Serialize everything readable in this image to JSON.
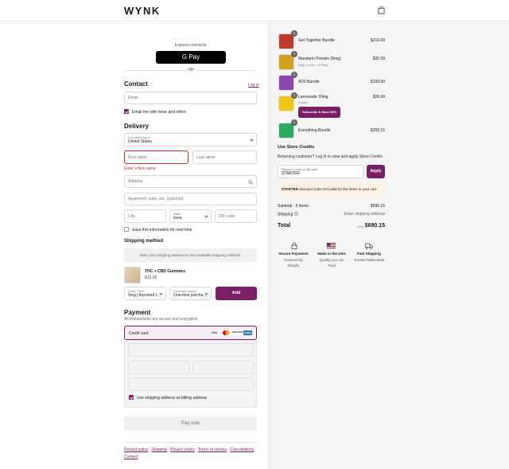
{
  "brand": {
    "logo": "WYNK",
    "accent": "#7a1f66",
    "error": "#d92d20"
  },
  "icons": {
    "cart": "shopping-bag-icon"
  },
  "express": {
    "label": "Express checkout",
    "gpay": "G Pay",
    "or": "OR"
  },
  "contact": {
    "title": "Contact",
    "login": "Log in",
    "email_placeholder": "Email",
    "newsletter": "Email me with news and offers",
    "newsletter_checked": true
  },
  "delivery": {
    "title": "Delivery",
    "country_label": "Country/Region",
    "country_value": "United States",
    "first_name": "First name",
    "last_name": "Last name",
    "first_name_error": "Enter a first name",
    "address": "Address",
    "apartment": "Apartment, suite, etc. (optional)",
    "city": "City",
    "state_label": "State",
    "state_value": "Iowa",
    "zip": "ZIP code",
    "save_info": "Save this information for next time"
  },
  "shipping_method": {
    "title": "Shipping method",
    "notice": "Enter your shipping address to view available shipping methods."
  },
  "upsell": {
    "name": "THC + CBD Gummies",
    "price": "$19.99",
    "dose_label": "Dose / Size",
    "dose_value": "5mg | Assorted f...",
    "purchase_label": "Purchase option",
    "purchase_value": "One-time purcha...",
    "add": "Add"
  },
  "payment": {
    "title": "Payment",
    "subtitle": "All transactions are secure and encrypted.",
    "method": "Credit card",
    "cards": [
      "VISA",
      "MC",
      "DISCOVER",
      "AMEX"
    ],
    "billing_same": "Use shipping address as billing address",
    "pay_now": "Pay now"
  },
  "footer": {
    "links": [
      "Refund policy",
      "Shipping",
      "Privacy policy",
      "Terms of service",
      "Cancellations",
      "Contact"
    ]
  },
  "cart": {
    "items": [
      {
        "name": "Get Together Bundle",
        "sub": "",
        "qty": "1",
        "price": "$219.99",
        "color": "#c0392b"
      },
      {
        "name": "Mandarin Pomelo (5mg)",
        "sub": "5Mg / 12oz) - 6 Pack",
        "qty": "1",
        "price": "$35.99",
        "color": "#d4a017"
      },
      {
        "name": "4/20 Bundle",
        "sub": "",
        "qty": "1",
        "price": "$199.00",
        "color": "#8e44ad"
      },
      {
        "name": "Lemonade 10mg",
        "sub": "4 pack",
        "qty": "1",
        "price": "$26.99",
        "color": "#f1c40f"
      },
      {
        "name": "Everything Bundle",
        "sub": "",
        "qty": "1",
        "price": "$208.15",
        "color": "#27ae60"
      }
    ],
    "subscribe_label": "Subscribe & Save 20%"
  },
  "store_credit": {
    "title": "Use Store Credits",
    "text": "Returning customer? Log in to view and apply Store Credits"
  },
  "discount": {
    "label": "Discount code or gift card",
    "value": "STARTER",
    "apply": "Apply",
    "code": "STARTER",
    "notice": " discount code isn't valid for the items in your cart"
  },
  "summary": {
    "subtotal_label": "Subtotal · 5 items",
    "subtotal": "$690.15",
    "shipping_label": "Shipping",
    "shipping_value": "Enter shipping address",
    "total_label": "Total",
    "currency": "USD",
    "total": "$690.15"
  },
  "badges": [
    {
      "title": "Secure Payments",
      "sub1": "Powered by",
      "sub2": "Shopify",
      "icon": "lock-icon"
    },
    {
      "title": "Made in the USA",
      "sub1": "Quality you can",
      "sub2": "Trust",
      "icon": "us-flag-icon"
    },
    {
      "title": "Fast Shipping",
      "sub1": "Trusted Nationwide",
      "sub2": "",
      "icon": "truck-icon"
    }
  ]
}
